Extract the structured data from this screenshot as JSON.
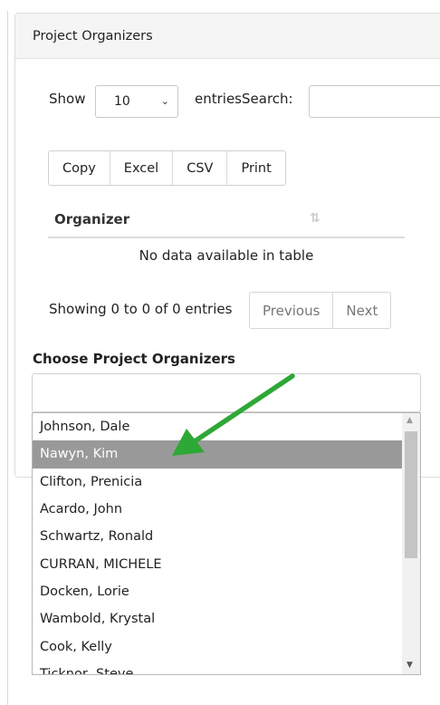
{
  "panel": {
    "title": "Project Organizers"
  },
  "table_controls": {
    "show_label": "Show",
    "page_length": "10",
    "entries_label": "entries",
    "search_label": "Search:",
    "search_value": ""
  },
  "export_buttons": [
    "Copy",
    "Excel",
    "CSV",
    "Print"
  ],
  "table": {
    "column_header": "Organizer",
    "empty_message": "No data available in table",
    "info": "Showing 0 to 0 of 0 entries"
  },
  "pagination": {
    "previous": "Previous",
    "next": "Next"
  },
  "chooser": {
    "label": "Choose Project Organizers",
    "input_value": "",
    "options": [
      "Johnson, Dale",
      "Nawyn, Kim",
      "Clifton, Prenicia",
      "Acardo, John",
      "Schwartz, Ronald",
      "CURRAN, MICHELE",
      "Docken, Lorie",
      "Wambold, Krystal",
      "Cook, Kelly",
      "Ticknor, Steve"
    ],
    "highlighted_option": "Nawyn, Kim"
  },
  "icons": {
    "sort": "sort-icon",
    "select_caret": "chevron-down-icon",
    "annotation": "green-arrow-icon"
  },
  "colors": {
    "highlight_bg": "#999999",
    "arrow": "#2ea836",
    "header_bg": "#f5f5f5"
  }
}
